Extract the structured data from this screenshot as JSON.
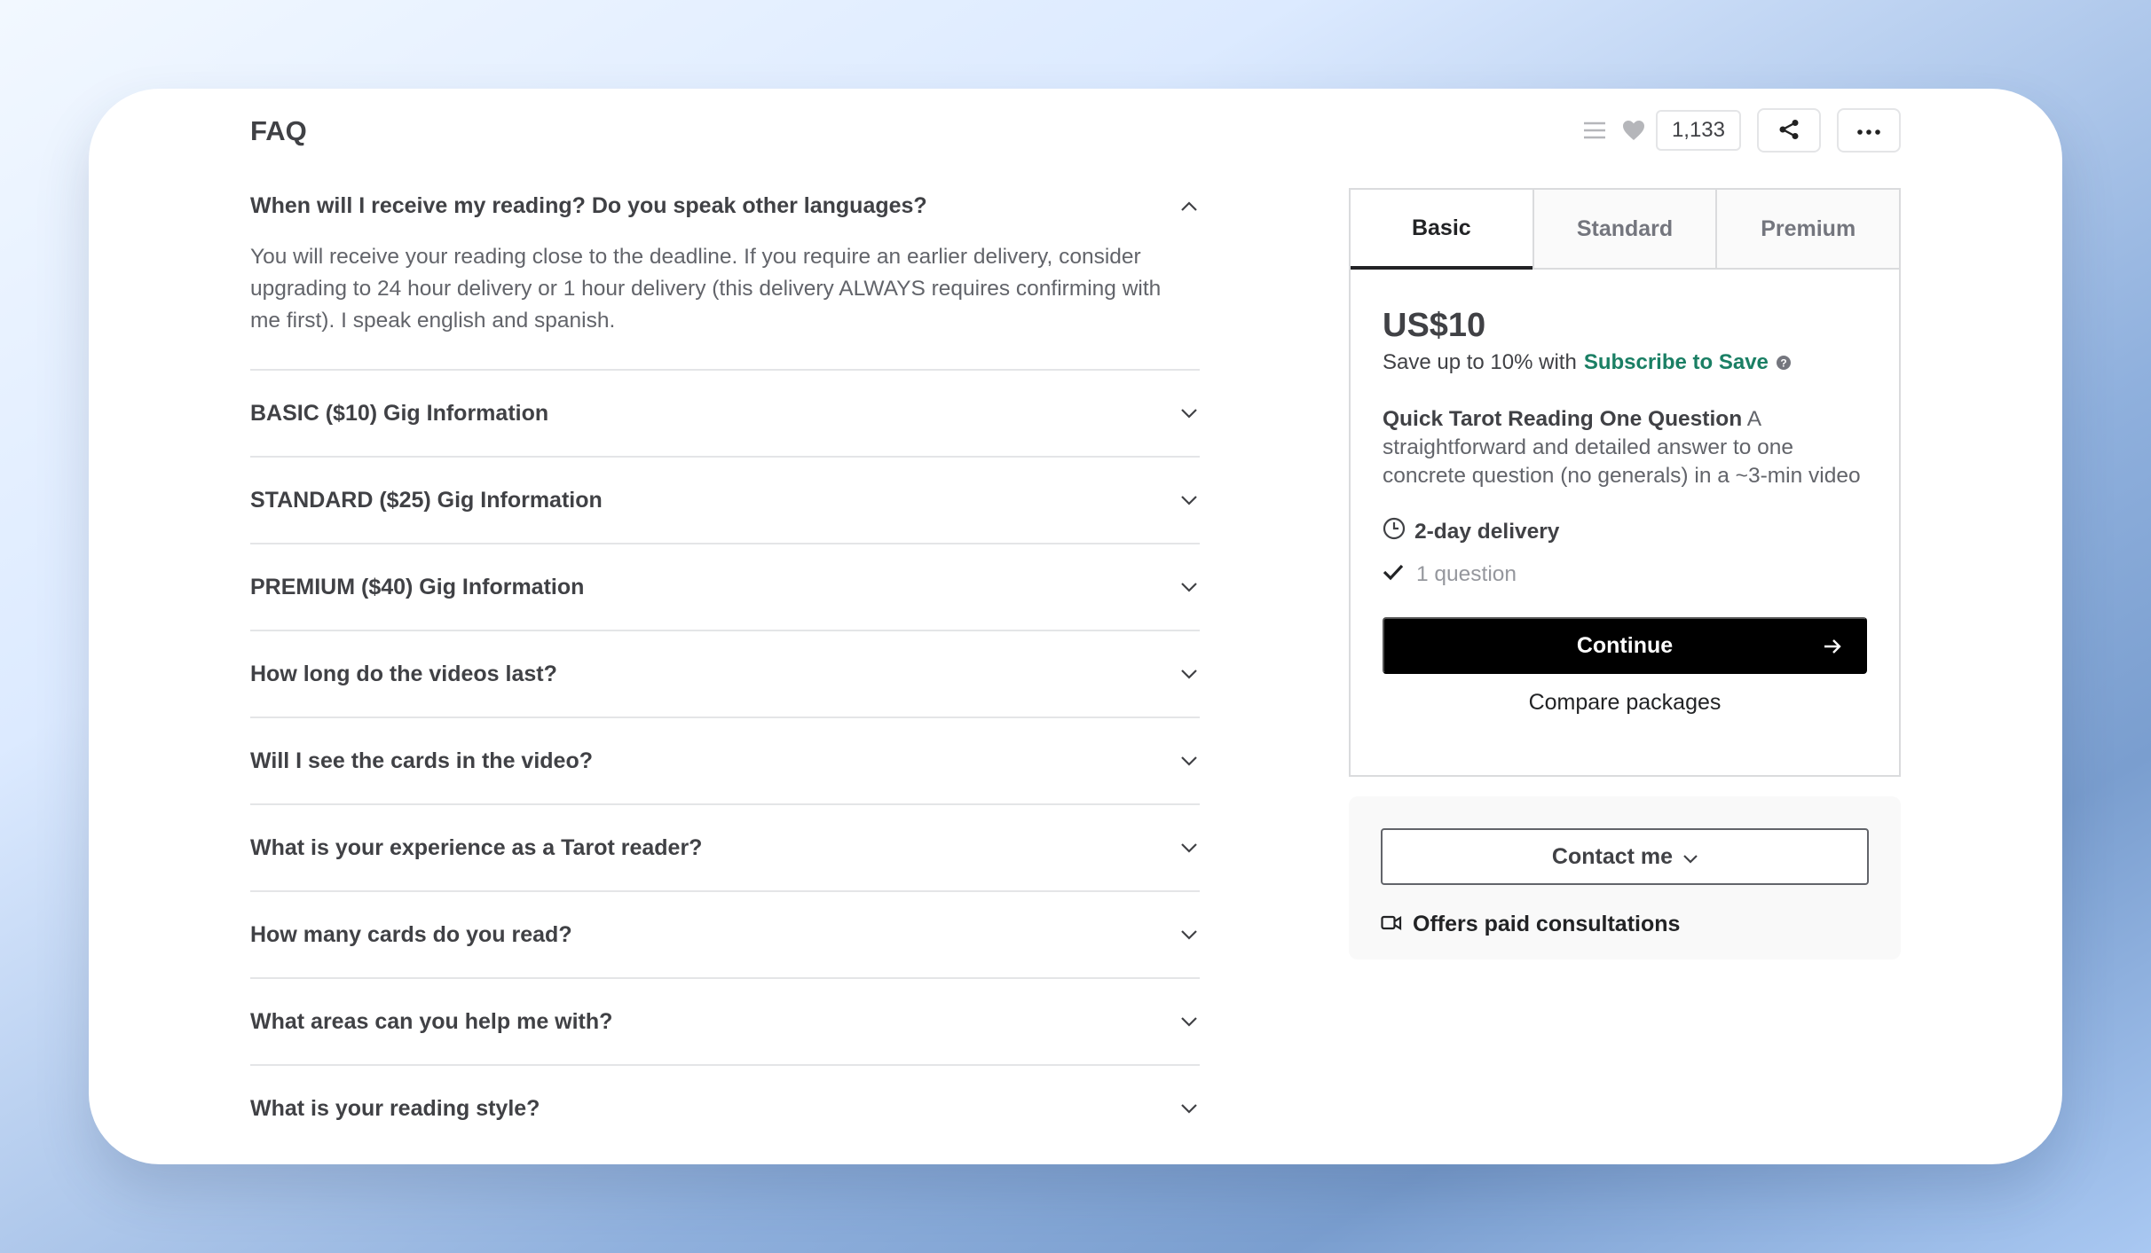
{
  "faq": {
    "title": "FAQ",
    "items": [
      {
        "question": "When will I receive my reading? Do you speak other languages?",
        "answer": "You will receive your reading close to the deadline. If you require an earlier delivery, consider upgrading to 24 hour delivery or 1 hour delivery (this delivery ALWAYS requires confirming with me first). I speak english and spanish.",
        "expanded": true
      },
      {
        "question": "BASIC ($10) Gig Information",
        "expanded": false
      },
      {
        "question": "STANDARD ($25) Gig Information",
        "expanded": false
      },
      {
        "question": "PREMIUM ($40) Gig Information",
        "expanded": false
      },
      {
        "question": "How long do the videos last?",
        "expanded": false
      },
      {
        "question": "Will I see the cards in the video?",
        "expanded": false
      },
      {
        "question": "What is your experience as a Tarot reader?",
        "expanded": false
      },
      {
        "question": "How many cards do you read?",
        "expanded": false
      },
      {
        "question": "What areas can you help me with?",
        "expanded": false
      },
      {
        "question": "What is your reading style?",
        "expanded": false
      }
    ]
  },
  "actions": {
    "like_count": "1,133",
    "icons": [
      "list-icon",
      "heart-icon",
      "share-icon",
      "more-icon"
    ]
  },
  "package": {
    "tabs": [
      "Basic",
      "Standard",
      "Premium"
    ],
    "active_tab": "Basic",
    "price": "US$10",
    "save_prefix": "Save up to 10% with",
    "save_link": "Subscribe to Save",
    "title": "Quick Tarot Reading One Question",
    "description": "A straightforward and detailed answer to one concrete question (no generals) in a ~3-min video",
    "delivery": "2-day delivery",
    "features": [
      "1 question"
    ],
    "continue_label": "Continue",
    "compare_label": "Compare packages"
  },
  "contact": {
    "button_label": "Contact me",
    "consultations": "Offers paid consultations"
  },
  "colors": {
    "accent_green": "#1a7f64",
    "button_black": "#000000"
  }
}
